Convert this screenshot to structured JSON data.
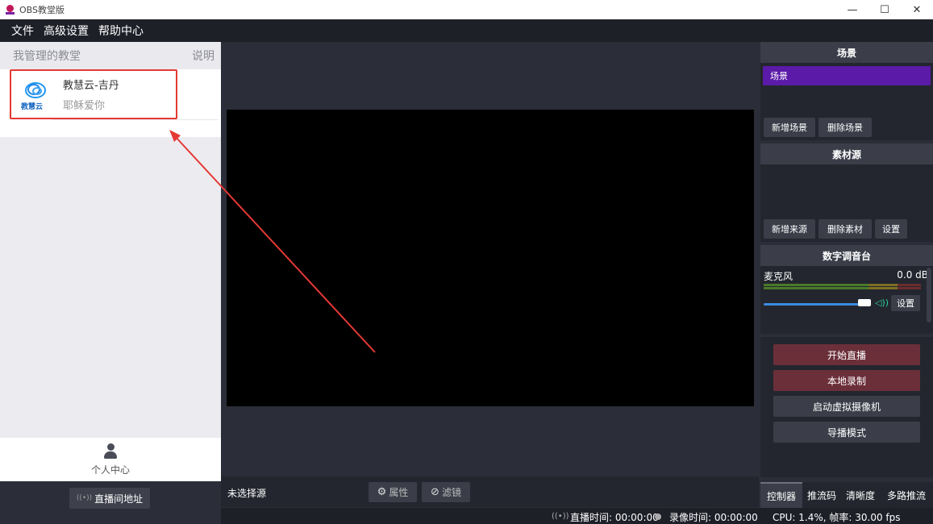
{
  "window": {
    "title": "OBS教堂版",
    "controls": [
      "—",
      "☐",
      "✕"
    ]
  },
  "menu": [
    "文件",
    "高级设置",
    "帮助中心"
  ],
  "left": {
    "header_title": "我管理的教堂",
    "header_link": "说明",
    "rooms": [
      {
        "logo_text": "教慧云",
        "name": "教慧云-吉丹",
        "subtitle": "耶稣爱你"
      }
    ],
    "personal_center": "个人中心",
    "live_address_button": "直播间地址",
    "live_address_icon": "((•))"
  },
  "center": {
    "no_source": "未选择源",
    "properties_button": "属性",
    "filters_button": "滤镜"
  },
  "scenes": {
    "title": "场景",
    "items": [
      "场景"
    ],
    "add_button": "新增场景",
    "delete_button": "删除场景"
  },
  "sources": {
    "title": "素材源",
    "add_button": "新增来源",
    "delete_button": "删除素材",
    "settings_button": "设置"
  },
  "mixer": {
    "title": "数字调音台",
    "channel": "麦克风",
    "level": "0.0 dB",
    "settings_button": "设置"
  },
  "controls": {
    "start_live": "开始直播",
    "local_record": "本地录制",
    "virtual_camera": "启动虚拟摄像机",
    "director_mode": "导播模式"
  },
  "tabs": [
    "控制器",
    "推流码",
    "清晰度",
    "多路推流"
  ],
  "status": {
    "live_icon": "((•))",
    "live_time": "直播时间: 00:00:00",
    "record_time": "录像时间: 00:00:00",
    "cpu": "CPU: 1.4%, 帧率: 30.00 fps"
  },
  "colors": {
    "scene_selected": "#5b1aa8",
    "start_live_bg": "#6b2f3a",
    "highlight_box": "#e53935"
  }
}
